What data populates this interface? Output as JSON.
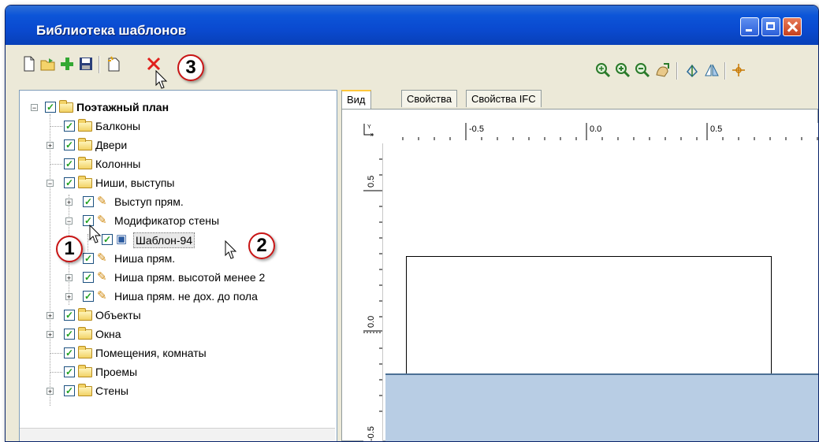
{
  "window": {
    "title": "Библиотека шаблонов"
  },
  "toolbar": {
    "left_icons": [
      "new-document-icon",
      "open-folder-icon",
      "add-plus-icon",
      "save-icon",
      "new-template-icon",
      "close-x-icon"
    ],
    "right_icons": [
      "zoom-extents-icon",
      "zoom-in-icon",
      "zoom-out-icon",
      "pan-icon",
      "rotate-icon",
      "mirror-icon",
      "snap-point-icon"
    ]
  },
  "callouts": {
    "c1": "1",
    "c2": "2",
    "c3": "3"
  },
  "tree": {
    "root": "Поэтажный план",
    "balconies": "Балконы",
    "doors": "Двери",
    "columns": "Колонны",
    "niches": "Ниши, выступы",
    "ledge": "Выступ прям.",
    "wall_modifier": "Модификатор стены",
    "template94": "Шаблон-94",
    "niche_rect": "Ниша прям.",
    "niche_rect_low": "Ниша прям. высотой менее 2",
    "niche_rect_floor": "Ниша прям. не дох. до пола",
    "objects": "Объекты",
    "windows": "Окна",
    "rooms": "Помещения, комнаты",
    "openings": "Проемы",
    "walls": "Стены"
  },
  "tabs": {
    "view": "Вид",
    "properties": "Свойства",
    "properties_ifc": "Свойства IFC"
  },
  "ruler": {
    "top": [
      "-0.5",
      "0.0",
      "0.5"
    ],
    "left": [
      "0.5",
      "0.0",
      "-0.5"
    ]
  },
  "colors": {
    "title_bar": "#0a4ad0",
    "floor_fill": "#b8cde4",
    "callout_border": "#c81414",
    "check_green": "#21a121"
  }
}
